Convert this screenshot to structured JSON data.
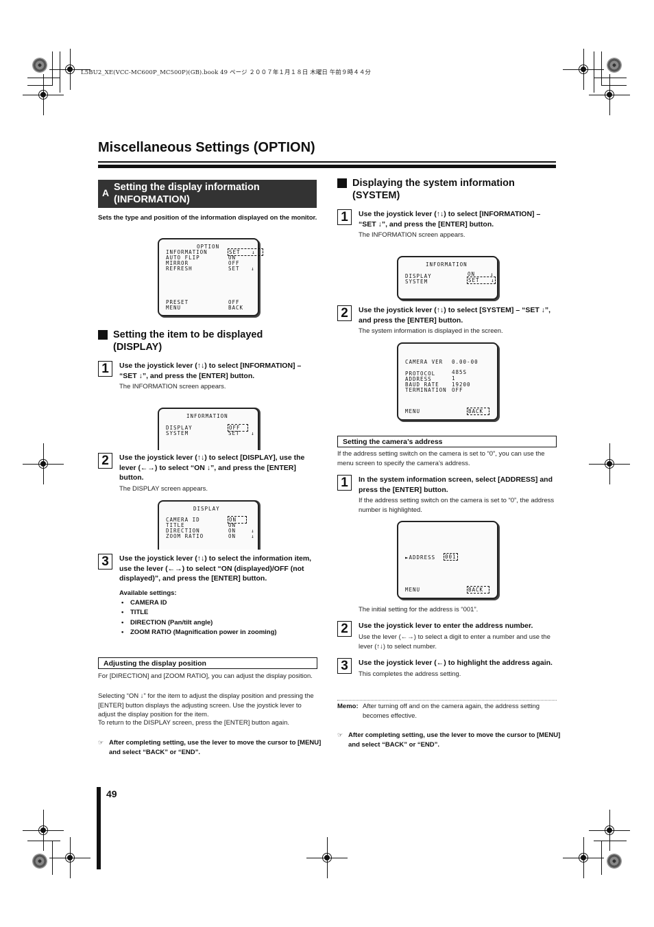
{
  "header_meta": "L5BU2_XE(VCC-MC600P_MC500P)(GB).book  49 ページ  ２００７年１月１８日  木曜日  午前９時４４分",
  "page_title": "Miscellaneous Settings (OPTION)",
  "page_number": "49",
  "left": {
    "section_a": {
      "letter": "A",
      "title_line1": "Setting the display information",
      "title_line2": "(INFORMATION)"
    },
    "intro": "Sets the type and position of the information displayed on the monitor.",
    "option_screen": {
      "title": "OPTION",
      "rows": [
        {
          "label": "INFORMATION",
          "value": "SET   ↓",
          "selected": true
        },
        {
          "label": "AUTO FLIP",
          "value": "ON"
        },
        {
          "label": "MIRROR",
          "value": "OFF"
        },
        {
          "label": "REFRESH",
          "value": "SET   ↓"
        },
        {
          "label": "PRESET",
          "value": "OFF"
        },
        {
          "label": "MENU",
          "value": "BACK"
        }
      ]
    },
    "display_heading_line1": "Setting the item to be displayed",
    "display_heading_line2": "(DISPLAY)",
    "steps": [
      {
        "num": "1",
        "text": "Use the joystick lever (↑↓) to select [INFORMATION] – “SET ↓”, and press the [ENTER] button.",
        "sub": "The INFORMATION screen appears."
      },
      {
        "num": "2",
        "text": "Use the joystick lever (↑↓) to select [DISPLAY], use the lever (←→) to select “ON ↓”, and press the [ENTER] button.",
        "sub": "The DISPLAY screen appears."
      },
      {
        "num": "3",
        "text": "Use the joystick lever (↑↓) to select the information item, use the lever (←→) to select “ON (displayed)/OFF (not displayed)”, and press the [ENTER] button."
      }
    ],
    "info_screen": {
      "title": "INFORMATION",
      "rows": [
        {
          "label": "DISPLAY",
          "value": "OFF",
          "selected": true
        },
        {
          "label": "SYSTEM",
          "value": "SET   ↓"
        }
      ]
    },
    "display_screen": {
      "title": "DISPLAY",
      "rows": [
        {
          "label": "CAMERA ID",
          "value": "ON",
          "selected": true
        },
        {
          "label": "TITLE",
          "value": "ON"
        },
        {
          "label": "DIRECTION",
          "value": "ON    ↓"
        },
        {
          "label": "ZOOM RATIO",
          "value": "ON    ↓"
        }
      ]
    },
    "available_label": "Available settings:",
    "available_settings": [
      "CAMERA ID",
      "TITLE",
      "DIRECTION (Pan/tilt angle)",
      "ZOOM RATIO (Magnification power in zooming)"
    ],
    "adjust_heading": "Adjusting the display position",
    "adjust_p1": "For [DIRECTION] and [ZOOM RATIO], you can adjust the display position.",
    "adjust_p2": "Selecting “ON ↓” for the item to adjust the display position and pressing the [ENTER] button displays the adjusting screen. Use the joystick lever to adjust the display position for the item.",
    "adjust_p3": "To return to the DISPLAY screen, press the [ENTER] button again.",
    "note": "After completing setting, use the lever to move the cursor to [MENU] and select “BACK” or “END”.",
    "note_icon": "☞"
  },
  "right": {
    "heading_line1": "Displaying the system information",
    "heading_line2": "(SYSTEM)",
    "steps": [
      {
        "num": "1",
        "text": "Use the joystick lever (↑↓) to select [INFORMATION] – “SET ↓”, and press the [ENTER] button.",
        "sub": "The INFORMATION screen appears."
      },
      {
        "num": "2",
        "text": "Use the joystick lever (↑↓) to select [SYSTEM] – “SET ↓”, and press the [ENTER] button.",
        "sub": "The system information is displayed in the screen."
      }
    ],
    "info_screen": {
      "title": "INFORMATION",
      "rows": [
        {
          "label": "DISPLAY",
          "value": "ON    ↓"
        },
        {
          "label": "SYSTEM",
          "value": "SET   ↓",
          "selected": true
        }
      ]
    },
    "system_screen": {
      "rows": [
        {
          "label": "CAMERA VER",
          "value": "0.00-00"
        },
        {
          "label": "PROTOCOL",
          "value": "485S"
        },
        {
          "label": "ADDRESS",
          "value": "1"
        },
        {
          "label": "BAUD RATE",
          "value": "19200"
        },
        {
          "label": "TERMINATION",
          "value": "OFF"
        }
      ],
      "menu_label": "MENU",
      "menu_value": "BACK"
    },
    "address_heading": "Setting the camera’s address",
    "address_intro": "If the address setting switch on the camera is set to “0”, you can use the menu screen to specify the camera’s address.",
    "address_steps": [
      {
        "num": "1",
        "text": "In the system information screen, select [ADDRESS] and press the [ENTER] button.",
        "sub": "If the address setting switch on the camera is set to “0”, the address number is highlighted."
      },
      {
        "num": "2",
        "text": "Use the joystick lever to enter the address number.",
        "sub": "Use the lever (←→) to select a digit to enter a number and use the lever (↑↓) to select number."
      },
      {
        "num": "3",
        "text": "Use the joystick lever (←) to highlight the address again.",
        "sub": "This completes the address setting."
      }
    ],
    "address_screen": {
      "label": "►ADDRESS",
      "value": "001",
      "menu_label": "MENU",
      "menu_value": "BACK"
    },
    "initial_setting": "The initial setting for the address is “001”.",
    "memo_label": "Memo:",
    "memo_text": "After turning off and on the camera again, the address setting becomes effective.",
    "note": "After completing setting, use the lever to move the cursor to [MENU] and select “BACK” or “END”.",
    "note_icon": "☞"
  }
}
